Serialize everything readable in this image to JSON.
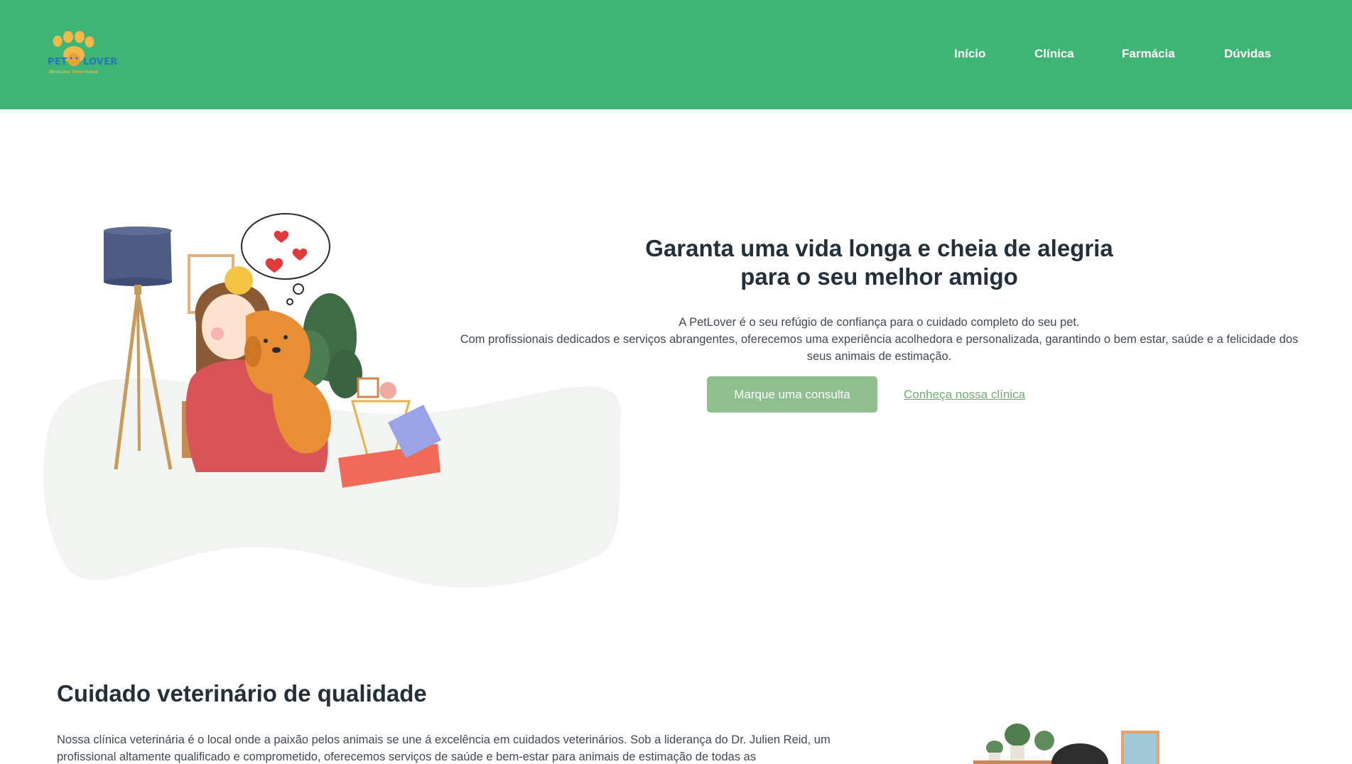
{
  "header": {
    "logo": {
      "brand_left": "PET",
      "brand_right": "LOVER",
      "subtitle": "Medicina Veterinária"
    },
    "nav": [
      {
        "label": "Início"
      },
      {
        "label": "Clínica"
      },
      {
        "label": "Farmácia"
      },
      {
        "label": "Dúvidas"
      }
    ]
  },
  "hero": {
    "title_line1": "Garanta uma vida longa e cheia de alegria",
    "title_line2": "para o seu melhor amigo",
    "text_line1": "A PetLover é o seu refúgio de confiança para o cuidado completo do seu pet.",
    "text_line2": "Com profissionais dedicados e serviços abrangentes, oferecemos uma experiência acolhedora e personalizada, garantindo o bem estar, saúde e a felicidade dos seus animais de estimação.",
    "primary_button": "Marque uma consulta",
    "secondary_link": "Conheça nossa clínica"
  },
  "quality": {
    "title": "Cuidado veterinário de qualidade",
    "text": "Nossa clínica veterinária é o local onde a paixão pelos animais se une á excelência em cuidados veterinários. Sob a liderança do Dr. Julien Reid, um profissional altamente qualificado e comprometido, oferecemos serviços de saúde e bem-estar para animais de estimação de todas as"
  },
  "colors": {
    "header_green": "#3eb575",
    "button_green": "#8fbf8f",
    "link_green": "#6fae6f",
    "blob_gray": "#f2f4f1",
    "logo_blue": "#2a75b8",
    "logo_yellow": "#f0b94a"
  },
  "icons": {
    "logo": "paw-icon"
  }
}
